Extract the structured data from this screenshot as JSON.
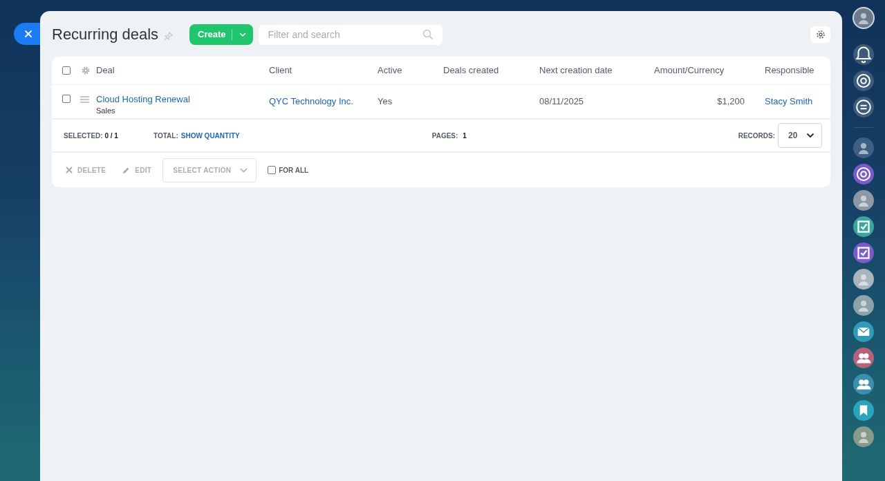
{
  "page": {
    "title": "Recurring deals"
  },
  "toolbar": {
    "create_button": "Create",
    "search": {
      "placeholder": "Filter and search"
    }
  },
  "table": {
    "header_checked": false,
    "columns": [
      "Deal",
      "Client",
      "Active",
      "Deals created",
      "Next creation date",
      "Amount/Currency",
      "Responsible"
    ],
    "rows": [
      {
        "checked": false,
        "deal": "Cloud Hosting Renewal",
        "pipeline": "Sales",
        "client": "QYC Technology Inc.",
        "active": "Yes",
        "next_date": "08/11/2025",
        "amount": "$1,200",
        "responsible": "Stacy Smith"
      }
    ]
  },
  "footer": {
    "selected_label": "SELECTED:",
    "selected_value": "0 / 1",
    "total_label": "TOTAL:",
    "total_link": "SHOW QUANTITY",
    "pages_label": "PAGES:",
    "pages_value": "1",
    "records_label": "RECORDS:",
    "records_value": "20"
  },
  "actions": {
    "delete": "DELETE",
    "edit": "EDIT",
    "select_action": "SELECT ACTION",
    "for_all": {
      "label": "FOR ALL",
      "checked": false
    }
  }
}
